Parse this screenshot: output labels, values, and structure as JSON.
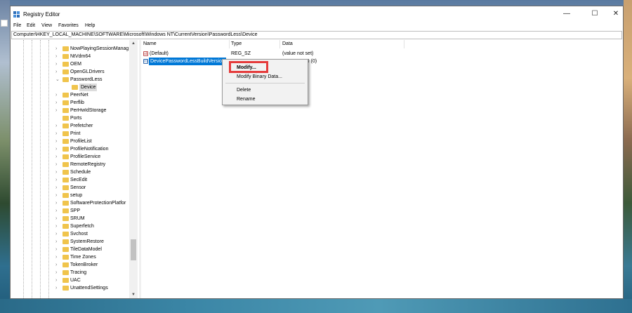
{
  "window": {
    "title": "Registry Editor",
    "controls": {
      "minimize": "—",
      "maximize": "☐",
      "close": "✕"
    }
  },
  "menu": [
    "File",
    "Edit",
    "View",
    "Favorites",
    "Help"
  ],
  "address": "Computer\\HKEY_LOCAL_MACHINE\\SOFTWARE\\Microsoft\\Windows NT\\CurrentVersion\\PasswordLess\\Device",
  "tree": {
    "items": [
      {
        "label": "NowPlayingSessionManag",
        "expander": "›"
      },
      {
        "label": "NtVdm64",
        "expander": "›"
      },
      {
        "label": "OEM",
        "expander": "›"
      },
      {
        "label": "OpenGLDrivers",
        "expander": "›"
      },
      {
        "label": "PasswordLess",
        "expander": "⌄"
      },
      {
        "label": "Device",
        "expander": ""
      },
      {
        "label": "PeerNet",
        "expander": "›"
      },
      {
        "label": "Perflib",
        "expander": "›"
      },
      {
        "label": "PerHwIdStorage",
        "expander": "›"
      },
      {
        "label": "Ports",
        "expander": ""
      },
      {
        "label": "Prefetcher",
        "expander": "›"
      },
      {
        "label": "Print",
        "expander": "›"
      },
      {
        "label": "ProfileList",
        "expander": "›"
      },
      {
        "label": "ProfileNotification",
        "expander": "›"
      },
      {
        "label": "ProfileService",
        "expander": "›"
      },
      {
        "label": "RemoteRegistry",
        "expander": "›"
      },
      {
        "label": "Schedule",
        "expander": "›"
      },
      {
        "label": "SecEdit",
        "expander": "›"
      },
      {
        "label": "Sensor",
        "expander": "›"
      },
      {
        "label": "setup",
        "expander": "›"
      },
      {
        "label": "SoftwareProtectionPlatfor",
        "expander": "›"
      },
      {
        "label": "SPP",
        "expander": "›"
      },
      {
        "label": "SRUM",
        "expander": "›"
      },
      {
        "label": "Superfetch",
        "expander": "›"
      },
      {
        "label": "Svchost",
        "expander": "›"
      },
      {
        "label": "SystemRestore",
        "expander": "›"
      },
      {
        "label": "TileDataModel",
        "expander": "›"
      },
      {
        "label": "Time Zones",
        "expander": "›"
      },
      {
        "label": "TokenBroker",
        "expander": "›"
      },
      {
        "label": "Tracing",
        "expander": "›"
      },
      {
        "label": "UAC",
        "expander": "›"
      },
      {
        "label": "UnattendSettings",
        "expander": "›"
      }
    ],
    "scroll_up": "▲",
    "scroll_down": "▼"
  },
  "list": {
    "columns": [
      "Name",
      "Type",
      "Data"
    ],
    "rows": [
      {
        "icon": "ab",
        "name": "(Default)",
        "type": "REG_SZ",
        "data": "(value not set)"
      },
      {
        "icon": "01",
        "name": "DevicePasswordLessBuildVersion",
        "type": "",
        "data": "0x00000000 (0)"
      }
    ]
  },
  "context_menu": {
    "items": [
      "Modify...",
      "Modify Binary Data...",
      "Delete",
      "Rename"
    ]
  },
  "colors": {
    "selection": "#0078d7",
    "highlight": "#e53b3b"
  }
}
